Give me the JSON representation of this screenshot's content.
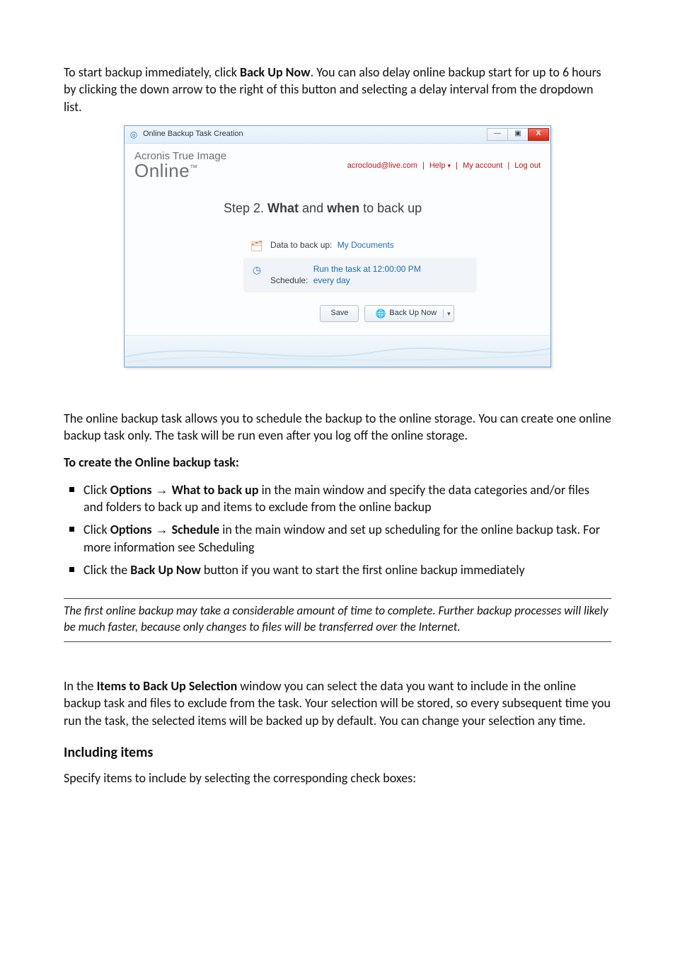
{
  "intro": {
    "pre": "To start backup immediately, click ",
    "bold": "Back Up Now",
    "post": ". You can also delay online backup start for up to 6 hours by clicking the down arrow to the right of this button and selecting a delay interval from the dropdown list."
  },
  "wizard": {
    "window_title": "Online Backup Task Creation",
    "brand_top": "Acronis True Image",
    "brand_main": "Online",
    "account_links": {
      "email": "acrocloud@live.com",
      "help": "Help",
      "my_account": "My account",
      "log_out": "Log out"
    },
    "step_title": {
      "prefix": "Step 2. ",
      "main1": "What",
      "mid": " and ",
      "main2": "when",
      "suffix": " to back up"
    },
    "data_row": {
      "label": "Data to back up:",
      "value": "My Documents"
    },
    "schedule_row": {
      "label": "Schedule:",
      "value": "Run the task at 12:00:00 PM every day"
    },
    "buttons": {
      "save": "Save",
      "back_up_now": "Back Up Now"
    },
    "win_btns": {
      "min": "—",
      "max": "▣",
      "close": "X"
    }
  },
  "after": {
    "para1": "The online backup task allows you to schedule the backup to the online storage. You can create one online backup task only. The task will be run even after you log off the online storage.",
    "heading_create": "To create the Online backup task:",
    "bullets": {
      "b1_pre": "Click ",
      "b1_bold1": "Options",
      "b1_arrow": " → ",
      "b1_bold2": "What to back up",
      "b1_post": " in the main window and specify the data categories and/or files and folders to back up and items to exclude from the online backup",
      "b2_pre": "Click ",
      "b2_bold1": "Options",
      "b2_arrow": " → ",
      "b2_bold2": "Schedule",
      "b2_post": " in the main window and set up scheduling for the online backup task. For more information see Scheduling",
      "b3_pre": "Click the ",
      "b3_bold": "Back Up Now",
      "b3_post": " button if you want to start the first online backup immediately"
    },
    "note": "The first online backup may take a considerable amount of time to complete. Further backup processes will likely be much faster, because only changes to files will be transferred over the Internet.",
    "para2_pre": "In the ",
    "para2_bold": "Items to Back Up Selection",
    "para2_post": " window you can select the data you want to include in the online backup task and files to exclude from the task. Your selection will be stored, so every subsequent time you run the task, the selected items will be backed up by default. You can change your selection any time.",
    "h_including": "Including items",
    "para3": "Specify items to include by selecting the corresponding check boxes:"
  }
}
